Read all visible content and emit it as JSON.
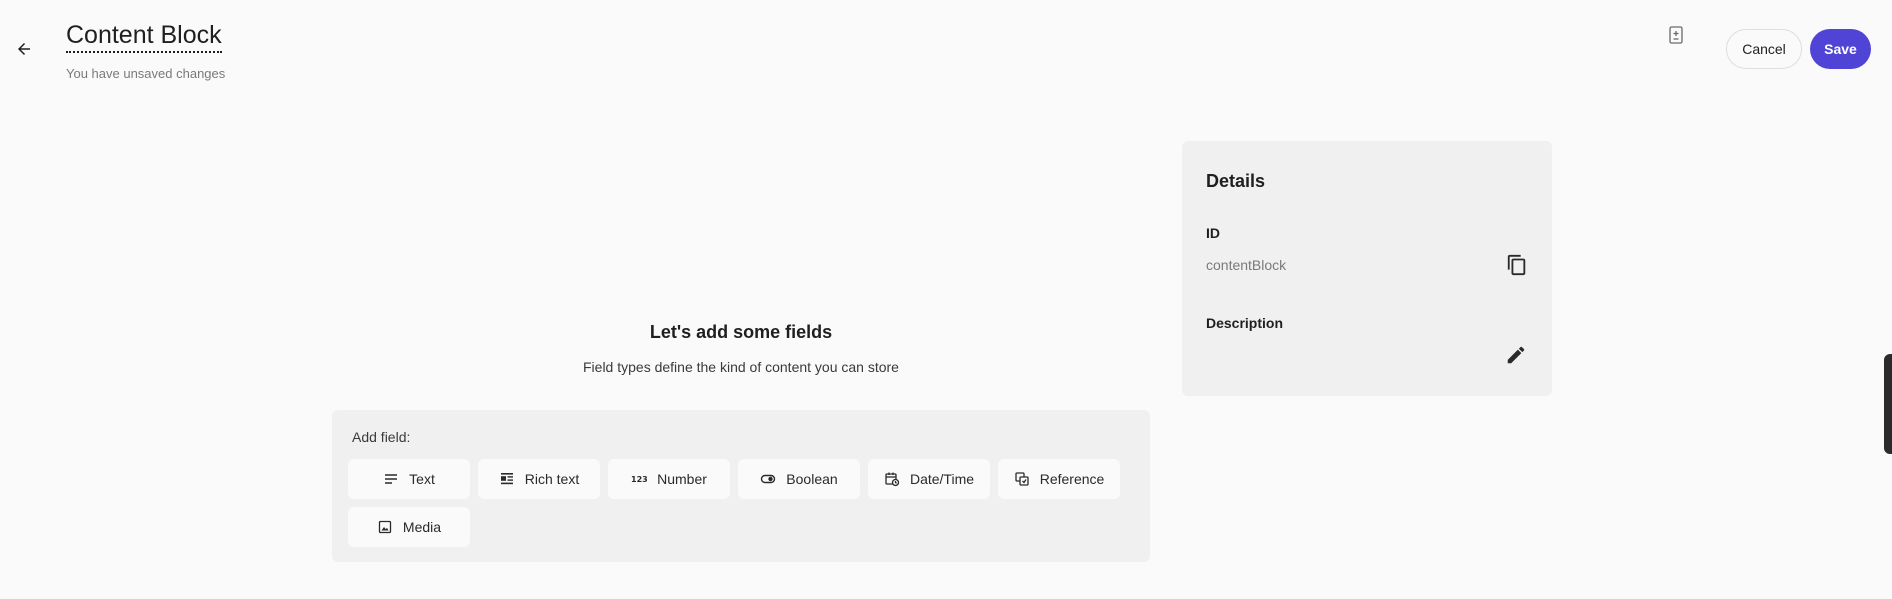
{
  "header": {
    "title": "Content Block",
    "subtitle": "You have unsaved changes",
    "cancel_label": "Cancel",
    "save_label": "Save"
  },
  "colors": {
    "accent": "#5044d6",
    "background": "#fafafa",
    "panel": "#f0f0f0"
  },
  "empty_state": {
    "heading": "Let's add some fields",
    "description": "Field types define the kind of content you can store"
  },
  "add_field": {
    "label": "Add field:",
    "types": [
      {
        "label": "Text",
        "icon": "text-lines-icon"
      },
      {
        "label": "Rich text",
        "icon": "rich-text-icon"
      },
      {
        "label": "Number",
        "icon": "number-123-icon"
      },
      {
        "label": "Boolean",
        "icon": "toggle-icon"
      },
      {
        "label": "Date/Time",
        "icon": "calendar-clock-icon"
      },
      {
        "label": "Reference",
        "icon": "reference-icon"
      },
      {
        "label": "Media",
        "icon": "image-icon"
      }
    ]
  },
  "details": {
    "title": "Details",
    "id_label": "ID",
    "id_value": "contentBlock",
    "description_label": "Description"
  }
}
